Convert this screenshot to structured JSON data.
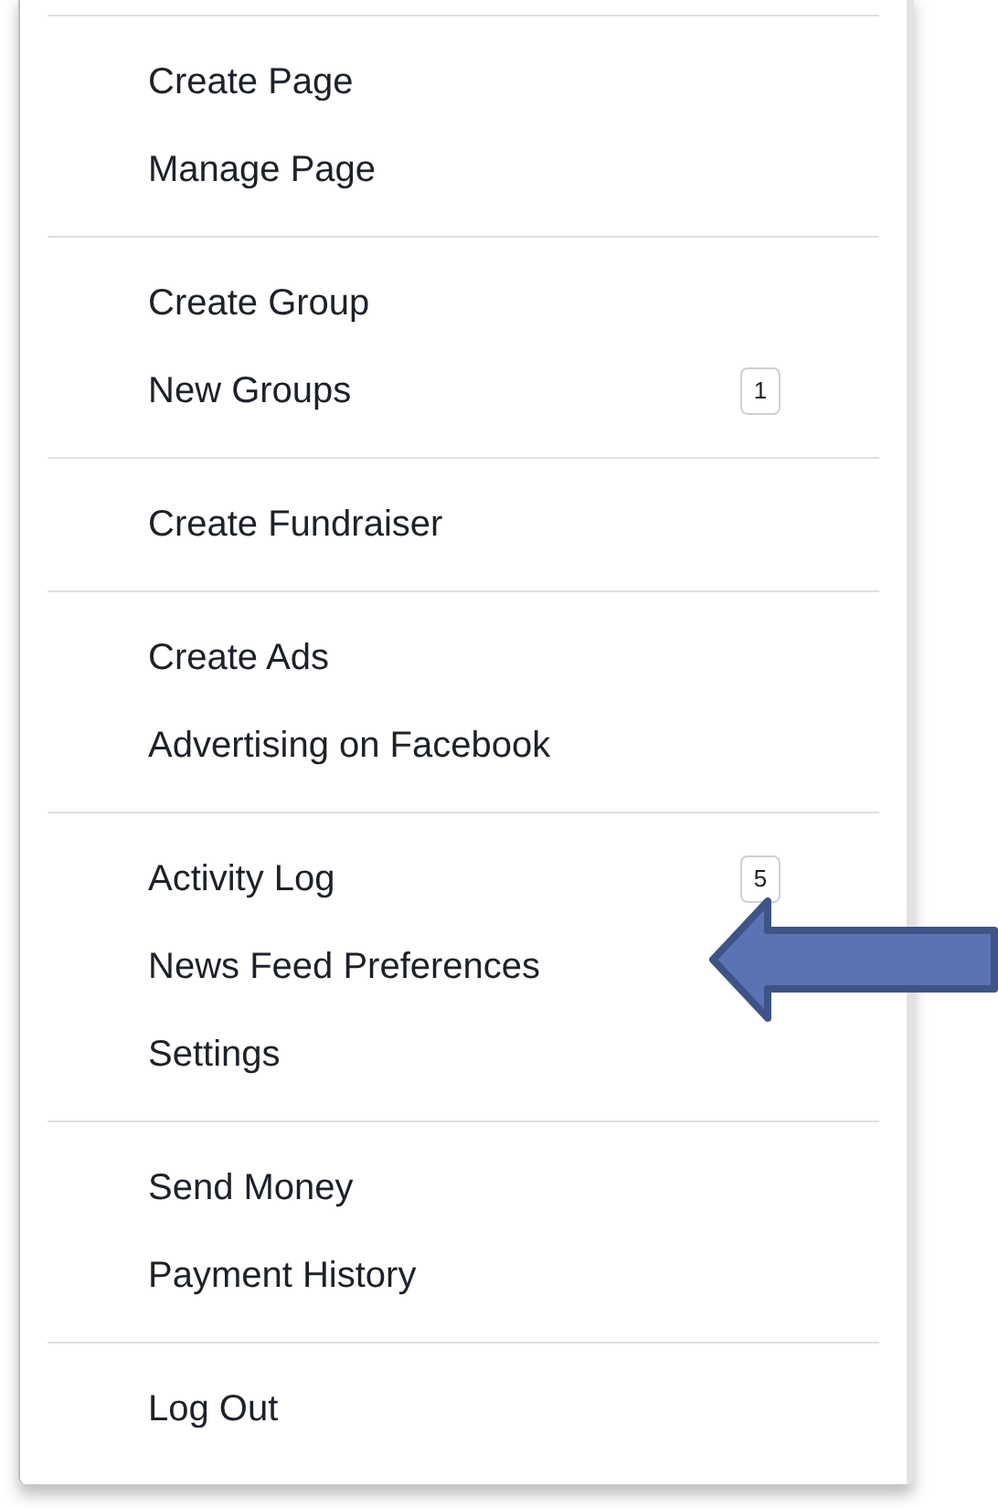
{
  "menu": {
    "sections": [
      {
        "items": [
          {
            "label": "Create Page"
          },
          {
            "label": "Manage Page"
          }
        ]
      },
      {
        "items": [
          {
            "label": "Create Group"
          },
          {
            "label": "New Groups",
            "badge": "1"
          }
        ]
      },
      {
        "items": [
          {
            "label": "Create Fundraiser"
          }
        ]
      },
      {
        "items": [
          {
            "label": "Create Ads"
          },
          {
            "label": "Advertising on Facebook"
          }
        ]
      },
      {
        "items": [
          {
            "label": "Activity Log",
            "badge": "5"
          },
          {
            "label": "News Feed Preferences"
          },
          {
            "label": "Settings"
          }
        ]
      },
      {
        "items": [
          {
            "label": "Send Money"
          },
          {
            "label": "Payment History"
          }
        ]
      },
      {
        "items": [
          {
            "label": "Log Out"
          }
        ]
      }
    ]
  }
}
